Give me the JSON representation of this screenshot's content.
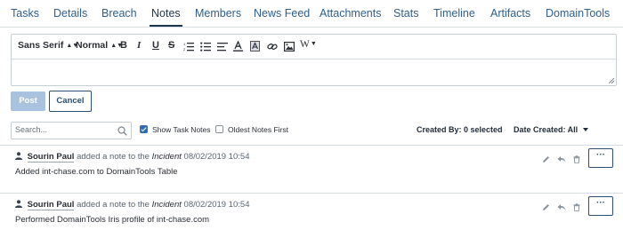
{
  "tabs": [
    "Tasks",
    "Details",
    "Breach",
    "Notes",
    "Members",
    "News Feed",
    "Attachments",
    "Stats",
    "Timeline",
    "Artifacts",
    "DomainTools"
  ],
  "active_tab": "Notes",
  "toolbar": {
    "font": "Sans Serif",
    "size": "Normal",
    "bold": "B",
    "italic": "I",
    "underline": "U",
    "strike": "S",
    "more": "W"
  },
  "buttons": {
    "post": "Post",
    "cancel": "Cancel"
  },
  "search": {
    "placeholder": "Search...",
    "value": ""
  },
  "filters": {
    "show_task_notes": "Show Task Notes",
    "show_task_notes_checked": true,
    "oldest_first": "Oldest Notes First",
    "oldest_first_checked": false,
    "created_by": "Created By: 0 selected",
    "date_created": "Date Created: All"
  },
  "notes": [
    {
      "author": "Sourin Paul",
      "action": "added a note to the",
      "target": "Incident",
      "timestamp": "08/02/2019 10:54",
      "text": "Added int-chase.com to DomainTools Table"
    },
    {
      "author": "Sourin Paul",
      "action": "added a note to the",
      "target": "Incident",
      "timestamp": "08/02/2019 10:54",
      "text": "Performed DomainTools Iris profile of int-chase.com"
    }
  ],
  "more_label": "···",
  "colors": {
    "accent": "#2c4f72",
    "link": "#2f5f8a",
    "post_disabled": "#a9c2dd",
    "checkbox": "#2f6fb0"
  },
  "icons": [
    "user-icon",
    "edit-icon",
    "reply-icon",
    "trash-icon",
    "search-icon"
  ]
}
